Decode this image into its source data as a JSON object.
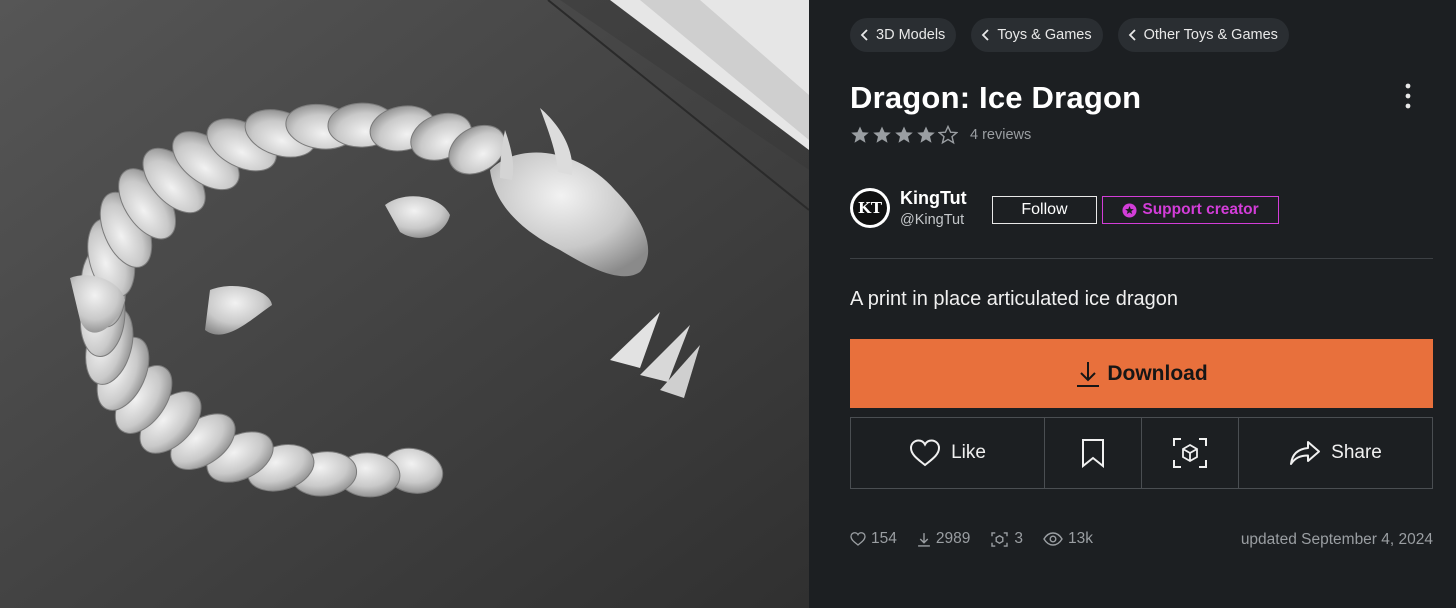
{
  "breadcrumbs": [
    {
      "label": "3D Models"
    },
    {
      "label": "Toys & Games"
    },
    {
      "label": "Other Toys & Games"
    }
  ],
  "model": {
    "title": "Dragon: Ice Dragon",
    "rating": 4,
    "rating_max": 5,
    "reviews_label": "4 reviews",
    "description": "A print in place articulated ice dragon"
  },
  "creator": {
    "name": "KingTut",
    "handle": "@KingTut",
    "avatar_text": "KT"
  },
  "buttons": {
    "follow": "Follow",
    "support": "Support creator",
    "download": "Download",
    "like": "Like",
    "share": "Share"
  },
  "stats": {
    "likes": "154",
    "downloads": "2989",
    "makes": "3",
    "views": "13k",
    "updated": "updated September 4, 2024"
  },
  "icons": {
    "more": "vertical-dots-icon",
    "star": "star-icon",
    "support": "star-badge-icon",
    "download": "download-arrow-icon",
    "like": "heart-icon",
    "save": "bookmark-icon",
    "ar": "ar-cube-icon",
    "share": "share-arrow-icon"
  },
  "colors": {
    "accent_download": "#e8703c",
    "support_magenta": "#d23dd8",
    "panel_bg": "#1c1f22",
    "star_fill": "#9a9ea2"
  }
}
